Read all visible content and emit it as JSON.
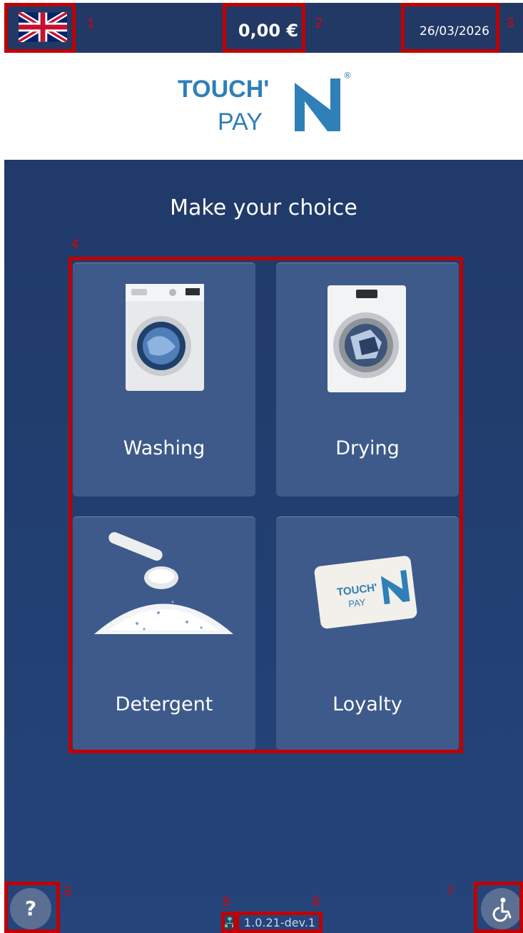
{
  "header": {
    "language_icon": "uk-flag-icon",
    "balance": "0,00 €",
    "date": "26/03/2026"
  },
  "logo": {
    "line1": "TOUCH'",
    "line2": "PAY",
    "mark": "N",
    "registered": "®"
  },
  "main": {
    "title": "Make your choice",
    "tiles": [
      {
        "label": "Washing",
        "icon": "washing-machine-icon"
      },
      {
        "label": "Drying",
        "icon": "dryer-icon"
      },
      {
        "label": "Detergent",
        "icon": "detergent-scoop-icon"
      },
      {
        "label": "Loyalty",
        "icon": "loyalty-card-icon"
      }
    ]
  },
  "footer": {
    "help_label": "?",
    "version": "1.0.21-dev.1",
    "accessibility_icon": "wheelchair-icon",
    "network_icon": "network-icon"
  },
  "annotations": [
    "1",
    "2",
    "3",
    "4",
    "5",
    "6",
    "7",
    "8"
  ],
  "colors": {
    "header_bg": "#223966",
    "main_bg": "#203a69",
    "tile_bg": "#3d5a8b",
    "annotation": "#c00000",
    "logo_blue": "#2f7fb8"
  }
}
